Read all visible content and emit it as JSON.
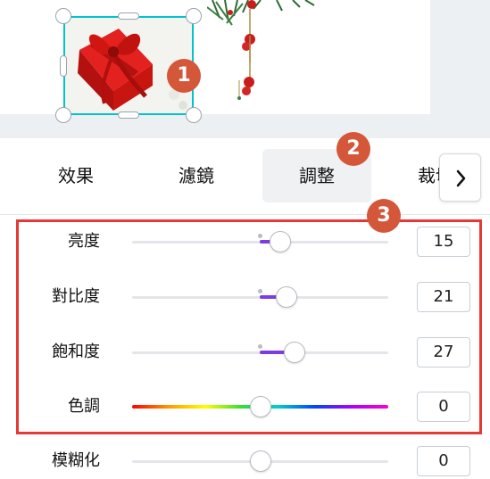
{
  "tabs": [
    {
      "label": "效果",
      "active": false
    },
    {
      "label": "濾鏡",
      "active": false
    },
    {
      "label": "調整",
      "active": true
    },
    {
      "label": "裁切",
      "active": false
    }
  ],
  "badges": [
    "1",
    "2",
    "3"
  ],
  "adjustments": [
    {
      "label": "亮度",
      "value": "15"
    },
    {
      "label": "對比度",
      "value": "21"
    },
    {
      "label": "飽和度",
      "value": "27"
    },
    {
      "label": "色調",
      "value": "0"
    },
    {
      "label": "模糊化",
      "value": "0"
    }
  ],
  "icons": {
    "next": "chevron-right-icon"
  },
  "colors": {
    "selection": "#00c4cc",
    "badge": "#d4573a",
    "slider_fill": "#7d3ce0",
    "highlight": "#e53935"
  }
}
